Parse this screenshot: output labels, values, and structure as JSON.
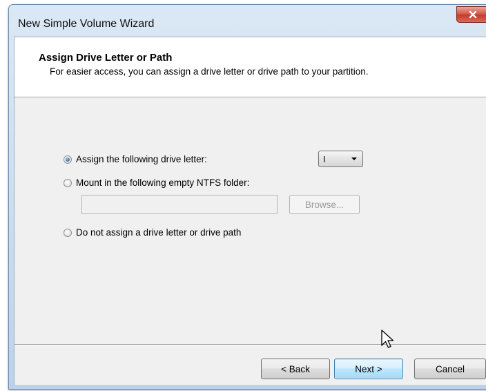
{
  "window": {
    "title": "New Simple Volume Wizard",
    "close_glyph": "x"
  },
  "header": {
    "title": "Assign Drive Letter or Path",
    "subtitle": "For easier access, you can assign a drive letter or drive path to your partition."
  },
  "options": {
    "assign_letter": {
      "label": "Assign the following drive letter:",
      "selected": true
    },
    "mount_folder": {
      "label": "Mount in the following empty NTFS folder:",
      "selected": false
    },
    "no_assign": {
      "label": "Do not assign a drive letter or drive path",
      "selected": false
    }
  },
  "drive_letter": {
    "value": "I"
  },
  "folder_path": {
    "value": ""
  },
  "buttons": {
    "browse": "Browse...",
    "back": "< Back",
    "next": "Next >",
    "cancel": "Cancel"
  },
  "colors": {
    "close_button": "#d8584a",
    "default_button": "#bee6fd",
    "radio_selected": "#2f6fb6"
  },
  "icons": [
    "close-icon",
    "dropdown-arrow-icon",
    "mouse-pointer-icon"
  ]
}
